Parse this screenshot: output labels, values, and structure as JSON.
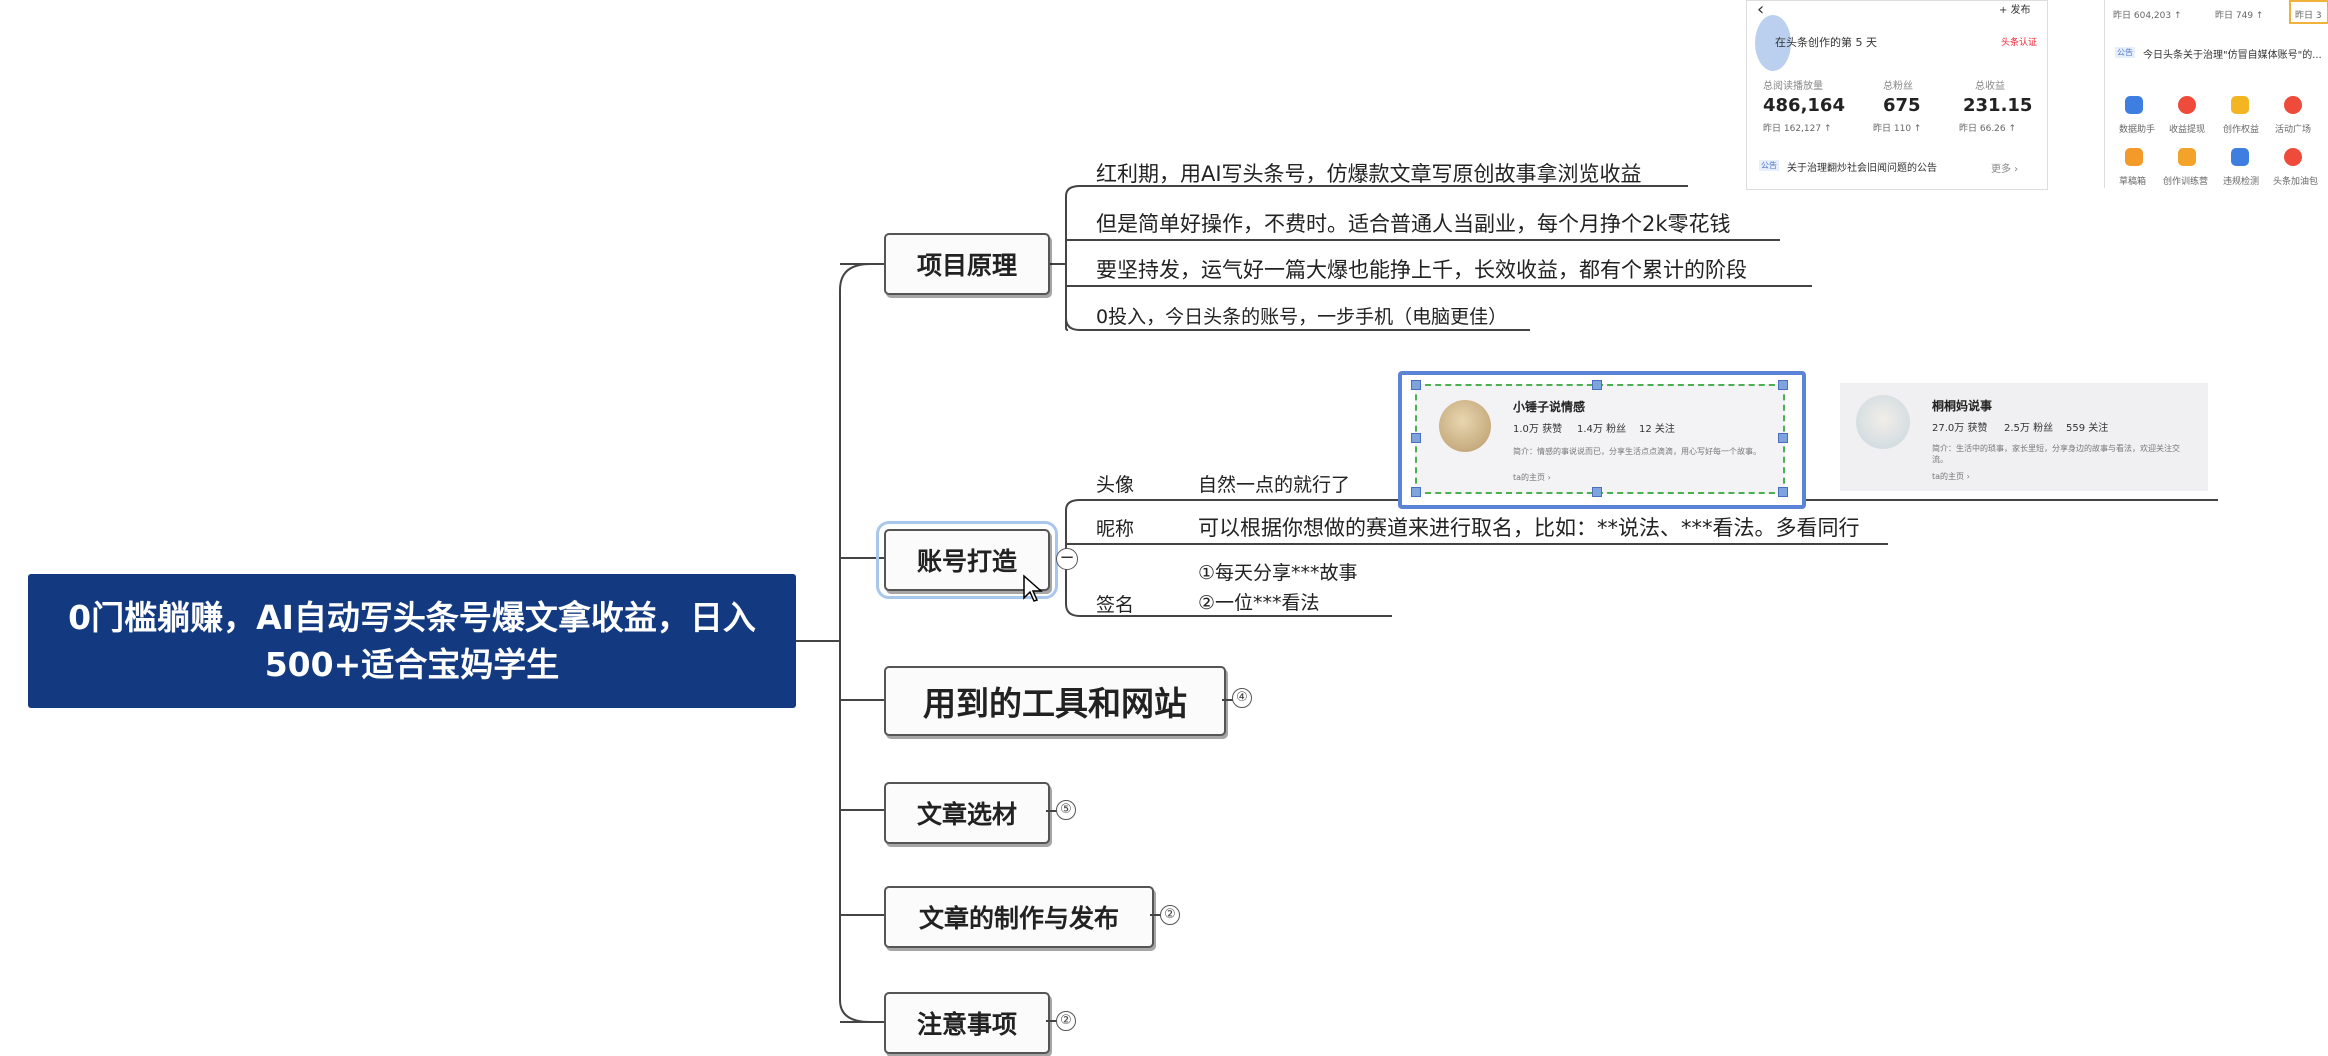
{
  "root": {
    "title": "0门槛躺赚，AI自动写头条号爆文拿收益，日入500+适合宝妈学生"
  },
  "topics": [
    {
      "label": "项目原理",
      "badge": ""
    },
    {
      "label": "账号打造",
      "badge": ""
    },
    {
      "label": "用到的工具和网站",
      "badge": "④"
    },
    {
      "label": "文章选材",
      "badge": "⑤"
    },
    {
      "label": "文章的制作与发布",
      "badge": "②"
    },
    {
      "label": "注意事项",
      "badge": "②"
    }
  ],
  "principle": [
    "红利期，用AI写头条号，仿爆款文章写原创故事拿浏览收益",
    "但是简单好操作，不费时。适合普通人当副业，每个月挣个2k零花钱",
    "要坚持发，运气好一篇大爆也能挣上千，长效收益，都有个累计的阶段",
    "0投入，今日头条的账号，一步手机（电脑更佳）"
  ],
  "account": {
    "avatar_label": "头像",
    "avatar_text": "自然一点的就行了",
    "nickname_label": "昵称",
    "nickname_text": "可以根据你想做的赛道来进行取名，比如：**说法、***看法。多看同行",
    "signature_label": "签名",
    "signature_line1": "①每天分享***故事",
    "signature_line2": "②一位***看法",
    "collapse_symbol": "−"
  },
  "inset": {
    "back": "‹",
    "publish": "+ 发布",
    "days": "在头条创作的第 5 天",
    "auth": "头条认证",
    "cap1": "总阅读播放量",
    "cap2": "总粉丝",
    "cap3": "总收益",
    "stat1": "486,164",
    "stat2": "675",
    "stat3": "231.15",
    "sub1": "昨日 162,127 ↑",
    "sub2": "昨日 110 ↑",
    "sub3": "昨日 66.26 ↑",
    "notice_tag": "公告",
    "notice": "关于治理翻炒社会旧闻问题的公告",
    "more": "更多 ›",
    "r_sub1": "昨日 604,203 ↑",
    "r_sub2": "昨日 749 ↑",
    "r_sub3": "昨日 3",
    "r_notice_tag": "公告",
    "r_notice": "今日头条关于治理\"仿冒自媒体账号\"的...",
    "icons": [
      "数据助手",
      "收益提现",
      "创作权益",
      "活动广场",
      "草稿箱",
      "创作训练营",
      "违规检测",
      "头条加油包"
    ]
  },
  "cards": {
    "card1_name": "小锤子说情感",
    "card1_stats": [
      "1.0万 获赞",
      "1.4万 粉丝",
      "12 关注"
    ],
    "card1_text": "简介：情感的事说说而已，分享生活点点滴滴，用心写好每一个故事。",
    "card1_tag": "ta的主页 ›",
    "card2_name": "桐桐妈说事",
    "card2_stats": [
      "27.0万 获赞",
      "2.5万 粉丝",
      "559 关注"
    ],
    "card2_text": "简介：生活中的琐事，家长里短，分享身边的故事与看法，欢迎关注交流。",
    "card2_tag": "ta的主页 ›"
  },
  "colors": {
    "root_bg": "#133a80",
    "line": "#444444",
    "selection": "#5b83d6",
    "dashed_select": "#4caf50"
  }
}
